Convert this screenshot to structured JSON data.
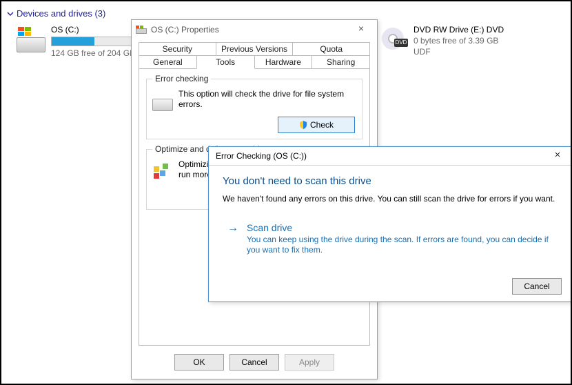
{
  "explorer": {
    "section_header": "Devices and drives (3)",
    "os_drive": {
      "title": "OS (C:)",
      "free_text": "124 GB free of 204 GB",
      "used_pct": 39
    },
    "dvd_drive": {
      "title": "DVD RW Drive (E:) DVD",
      "free_text": "0 bytes free of 3.39 GB",
      "fs": "UDF",
      "badge": "DVD"
    }
  },
  "properties": {
    "title": "OS (C:) Properties",
    "tabs_row1": [
      "Security",
      "Previous Versions",
      "Quota"
    ],
    "tabs_row2": [
      "General",
      "Tools",
      "Hardware",
      "Sharing"
    ],
    "active_tab": "Tools",
    "error_group": {
      "caption": "Error checking",
      "text": "This option will check the drive for file system errors.",
      "button": "Check"
    },
    "optimize_group": {
      "caption": "Optimize and defragment drive",
      "text": "Optimizing your computer's drives can help it run more efficiently."
    },
    "footer": {
      "ok": "OK",
      "cancel": "Cancel",
      "apply": "Apply"
    }
  },
  "errorcheck": {
    "title": "Error Checking (OS (C:))",
    "headline": "You don't need to scan this drive",
    "message": "We haven't found any errors on this drive. You can still scan the drive for errors if you want.",
    "option": {
      "name": "Scan drive",
      "sub": "You can keep using the drive during the scan. If errors are found, you can decide if you want to fix them."
    },
    "cancel": "Cancel"
  }
}
